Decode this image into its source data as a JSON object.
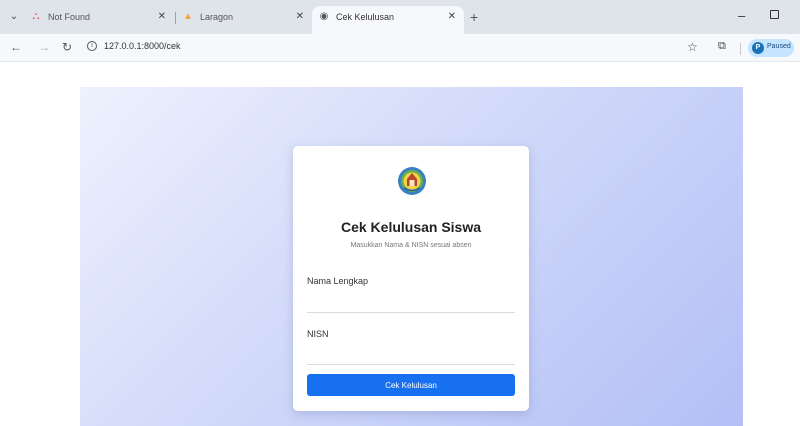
{
  "browser": {
    "tabs": [
      {
        "title": "Not Found",
        "active": false,
        "favicon": "laravel-icon"
      },
      {
        "title": "Laragon",
        "active": false,
        "favicon": "laragon-icon"
      },
      {
        "title": "Cek Kelulusan",
        "active": true,
        "favicon": "globe-icon"
      }
    ],
    "url": "127.0.0.1:8000/cek",
    "profile_initial": "P",
    "profile_label": "Paused"
  },
  "page": {
    "logo": "school-emblem",
    "title": "Cek Kelulusan Siswa",
    "subtitle": "Masukkan Nama & NISN sesuai absen",
    "name_label": "Nama Lengkap",
    "name_value": "",
    "nisn_label": "NISN",
    "nisn_value": "",
    "submit_label": "Cek Kelulusan"
  },
  "colors": {
    "accent": "#1670f0",
    "hero_start": "#eef1fd",
    "hero_end": "#b3bff6"
  }
}
